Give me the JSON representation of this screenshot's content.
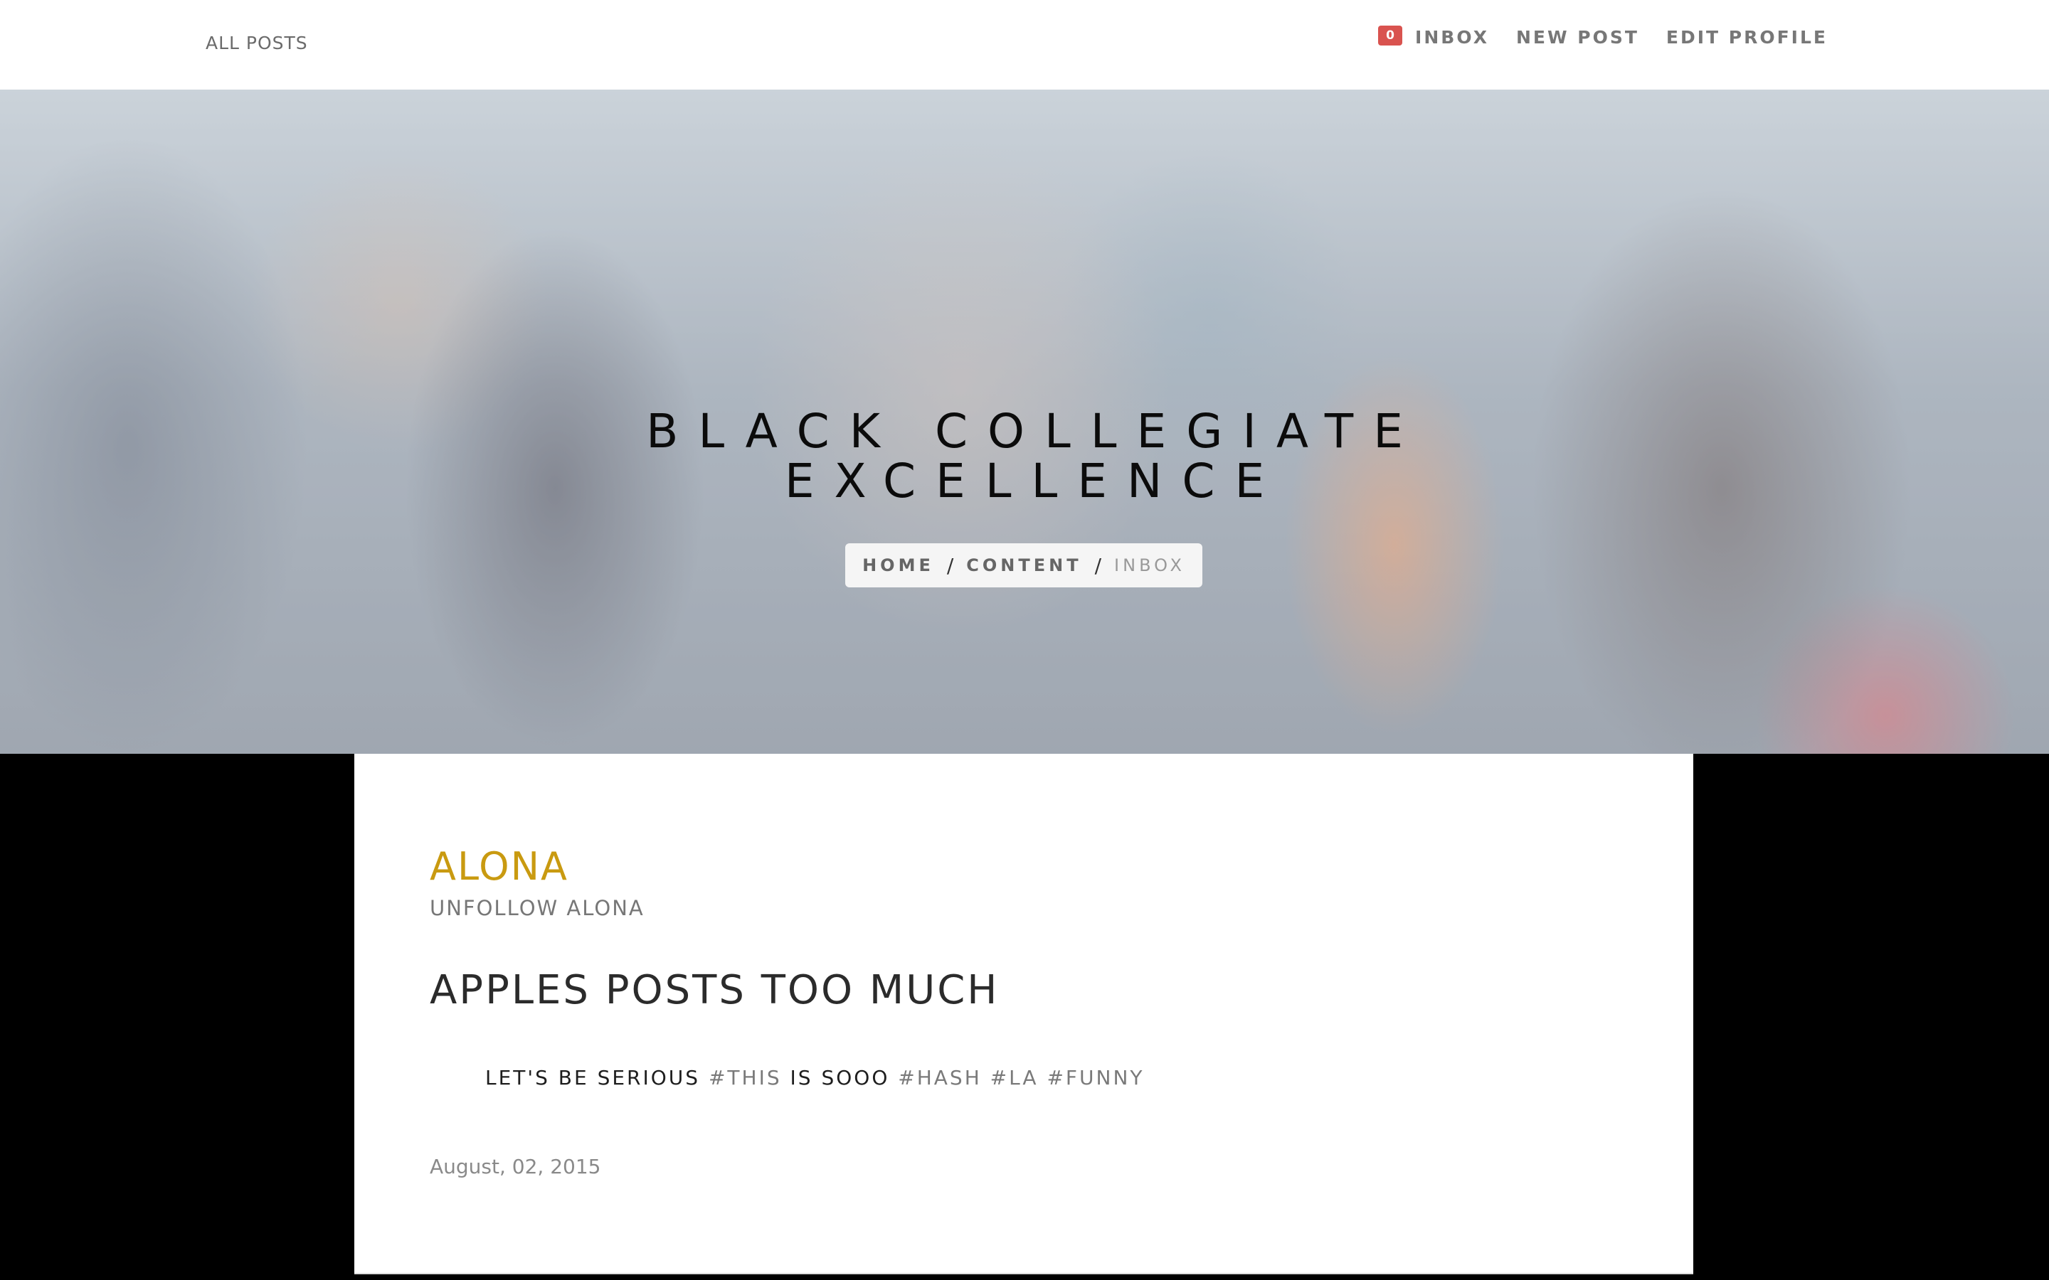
{
  "nav": {
    "brand": "ALL POSTS",
    "inbox_count": "0",
    "inbox_label": "INBOX",
    "new_post_label": "NEW POST",
    "edit_profile_label": "EDIT PROFILE"
  },
  "hero": {
    "title_line1": "BLACK COLLEGIATE",
    "title_line2": "EXCELLENCE",
    "breadcrumb": {
      "home": "HOME",
      "separator": "/",
      "content": "CONTENT",
      "current": "INBOX"
    }
  },
  "post": {
    "author": "ALONA",
    "unfollow_label": "UNFOLLOW ALONA",
    "title": "APPLES POSTS TOO MUCH",
    "body": {
      "text1": "LET'S BE SERIOUS",
      "tag1": "#THIS",
      "text2": "IS SOOO",
      "tag2": "#HASH",
      "tag3": "#LA",
      "tag4": "#FUNNY"
    },
    "date": "August, 02, 2015"
  },
  "colors": {
    "accent": "#c99a10",
    "badge": "#d9534f"
  }
}
